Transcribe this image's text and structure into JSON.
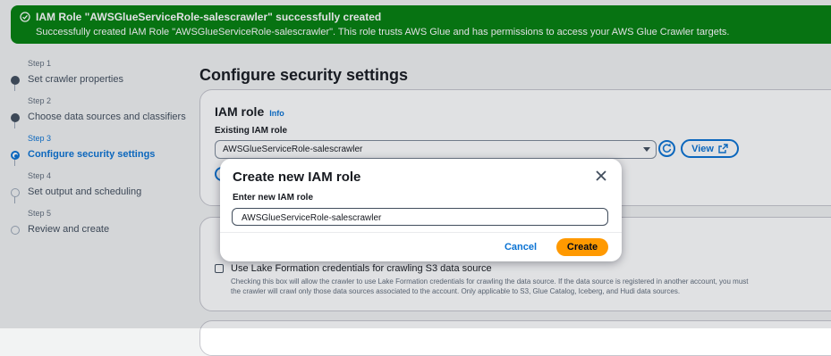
{
  "flash": {
    "title": "IAM Role \"AWSGlueServiceRole-salescrawler\" successfully created",
    "message": "Successfully created IAM Role \"AWSGlueServiceRole-salescrawler\". This role trusts AWS Glue and has permissions to access your AWS Glue Crawler targets.",
    "color": "#037f0c"
  },
  "steps": [
    {
      "num": "Step 1",
      "label": "Set crawler properties",
      "state": "done"
    },
    {
      "num": "Step 2",
      "label": "Choose data sources and classifiers",
      "state": "done"
    },
    {
      "num": "Step 3",
      "label": "Configure security settings",
      "state": "active"
    },
    {
      "num": "Step 4",
      "label": "Set output and scheduling",
      "state": "todo"
    },
    {
      "num": "Step 5",
      "label": "Review and create",
      "state": "todo"
    }
  ],
  "main": {
    "title": "Configure security settings",
    "iam_card": {
      "heading": "IAM role",
      "info": "Info",
      "field_label": "Existing IAM role",
      "selected_role": "AWSGlueServiceRole-salescrawler",
      "view_label": "View"
    },
    "lf_card": {
      "checkbox_label": "Use Lake Formation credentials for crawling S3 data source",
      "help_line1": "Checking this box will allow the crawler to use Lake Formation credentials for crawling the data source. If the data source is registered in another account, you must",
      "help_line2": "the crawler will crawl only those data sources associated to the account. Only applicable to S3, Glue Catalog, Iceberg, and Hudi data sources."
    }
  },
  "modal": {
    "title": "Create new IAM role",
    "field_label": "Enter new IAM role",
    "field_value": "AWSGlueServiceRole-salescrawler",
    "cancel_label": "Cancel",
    "create_label": "Create"
  },
  "colors": {
    "accent": "#0972d3",
    "primary_button": "#ff9900",
    "success": "#037f0c"
  }
}
